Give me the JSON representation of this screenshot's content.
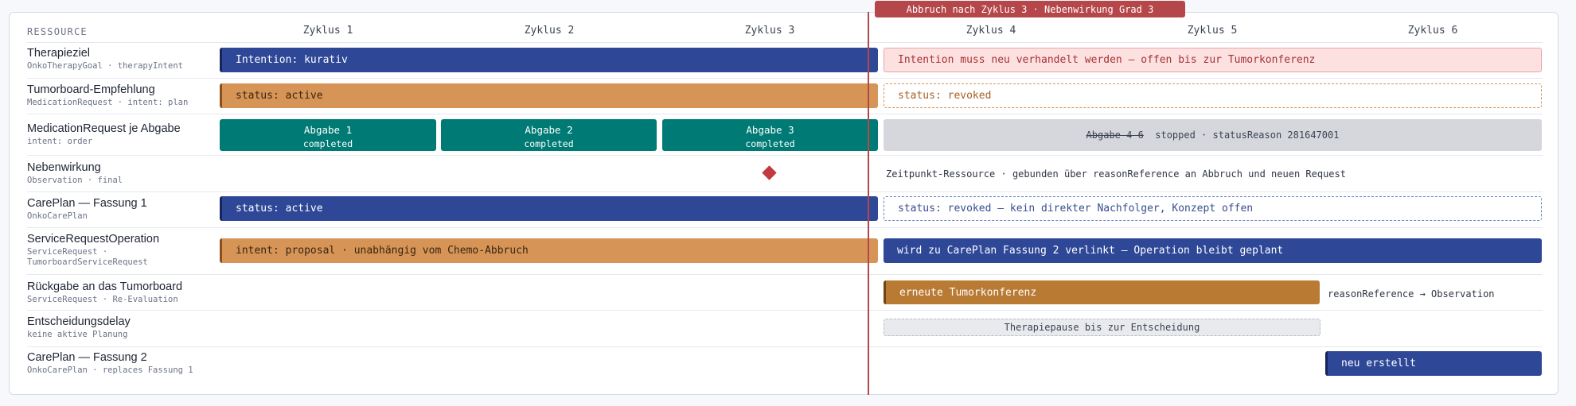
{
  "header": {
    "resource_label": "RESSOURCE",
    "cycles": [
      "Zyklus 1",
      "Zyklus 2",
      "Zyklus 3",
      "Zyklus 4",
      "Zyklus 5",
      "Zyklus 6"
    ]
  },
  "abort_marker": {
    "label": "Abbruch nach Zyklus 3 · Nebenwirkung Grad 3",
    "color": "#b5464a"
  },
  "rows": [
    {
      "title": "Therapieziel",
      "subtitle": "OnkoTherapyGoal · therapyIntent"
    },
    {
      "title": "Tumorboard-Empfehlung",
      "subtitle": "MedicationRequest · intent: plan"
    },
    {
      "title": "MedicationRequest je Abgabe",
      "subtitle": "intent: order"
    },
    {
      "title": "Nebenwirkung",
      "subtitle": "Observation · final"
    },
    {
      "title": "CarePlan — Fassung 1",
      "subtitle": "OnkoCarePlan"
    },
    {
      "title": "ServiceRequestOperation",
      "subtitle": "ServiceRequest ·",
      "subtitle2": "TumorboardServiceRequest"
    },
    {
      "title": "Rückgabe an das Tumorboard",
      "subtitle": "ServiceRequest · Re-Evaluation"
    },
    {
      "title": "Entscheidungsdelay",
      "subtitle": "keine aktive Planung"
    },
    {
      "title": "CarePlan — Fassung 2",
      "subtitle": "OnkoCarePlan · replaces Fassung 1"
    }
  ],
  "bars": {
    "therapieziel_before": "Intention: kurativ",
    "therapieziel_after": "Intention muss neu verhandelt werden — offen bis zur Tumorkonferenz",
    "tumorboard_before": "status: active",
    "tumorboard_after": "status: revoked",
    "abgaben": [
      {
        "label": "Abgabe 1",
        "status": "completed"
      },
      {
        "label": "Abgabe 2",
        "status": "completed"
      },
      {
        "label": "Abgabe 3",
        "status": "completed"
      }
    ],
    "abgaben_stopped_label": "Abgabe 4–6",
    "abgaben_stopped_text": "stopped · statusReason 281647001",
    "nebenwirkung_note": "Zeitpunkt-Ressource · gebunden über reasonReference an Abbruch und neuen Request",
    "careplan1_before": "status: active",
    "careplan1_after": "status: revoked — kein direkter Nachfolger, Konzept offen",
    "op_before": "intent: proposal · unabhängig vom Chemo-Abbruch",
    "op_after": "wird zu CarePlan Fassung 2 verlinkt — Operation bleibt geplant",
    "rueckgabe": "erneute Tumorkonferenz",
    "rueckgabe_note": "reasonReference → Observation",
    "delay": "Therapiepause bis zur Entscheidung",
    "careplan2": "neu erstellt"
  },
  "colors": {
    "blue": "#2e4797",
    "orange": "#d69457",
    "teal": "#007a74",
    "red": "#b5464a",
    "grey": "#d5d7dc"
  }
}
